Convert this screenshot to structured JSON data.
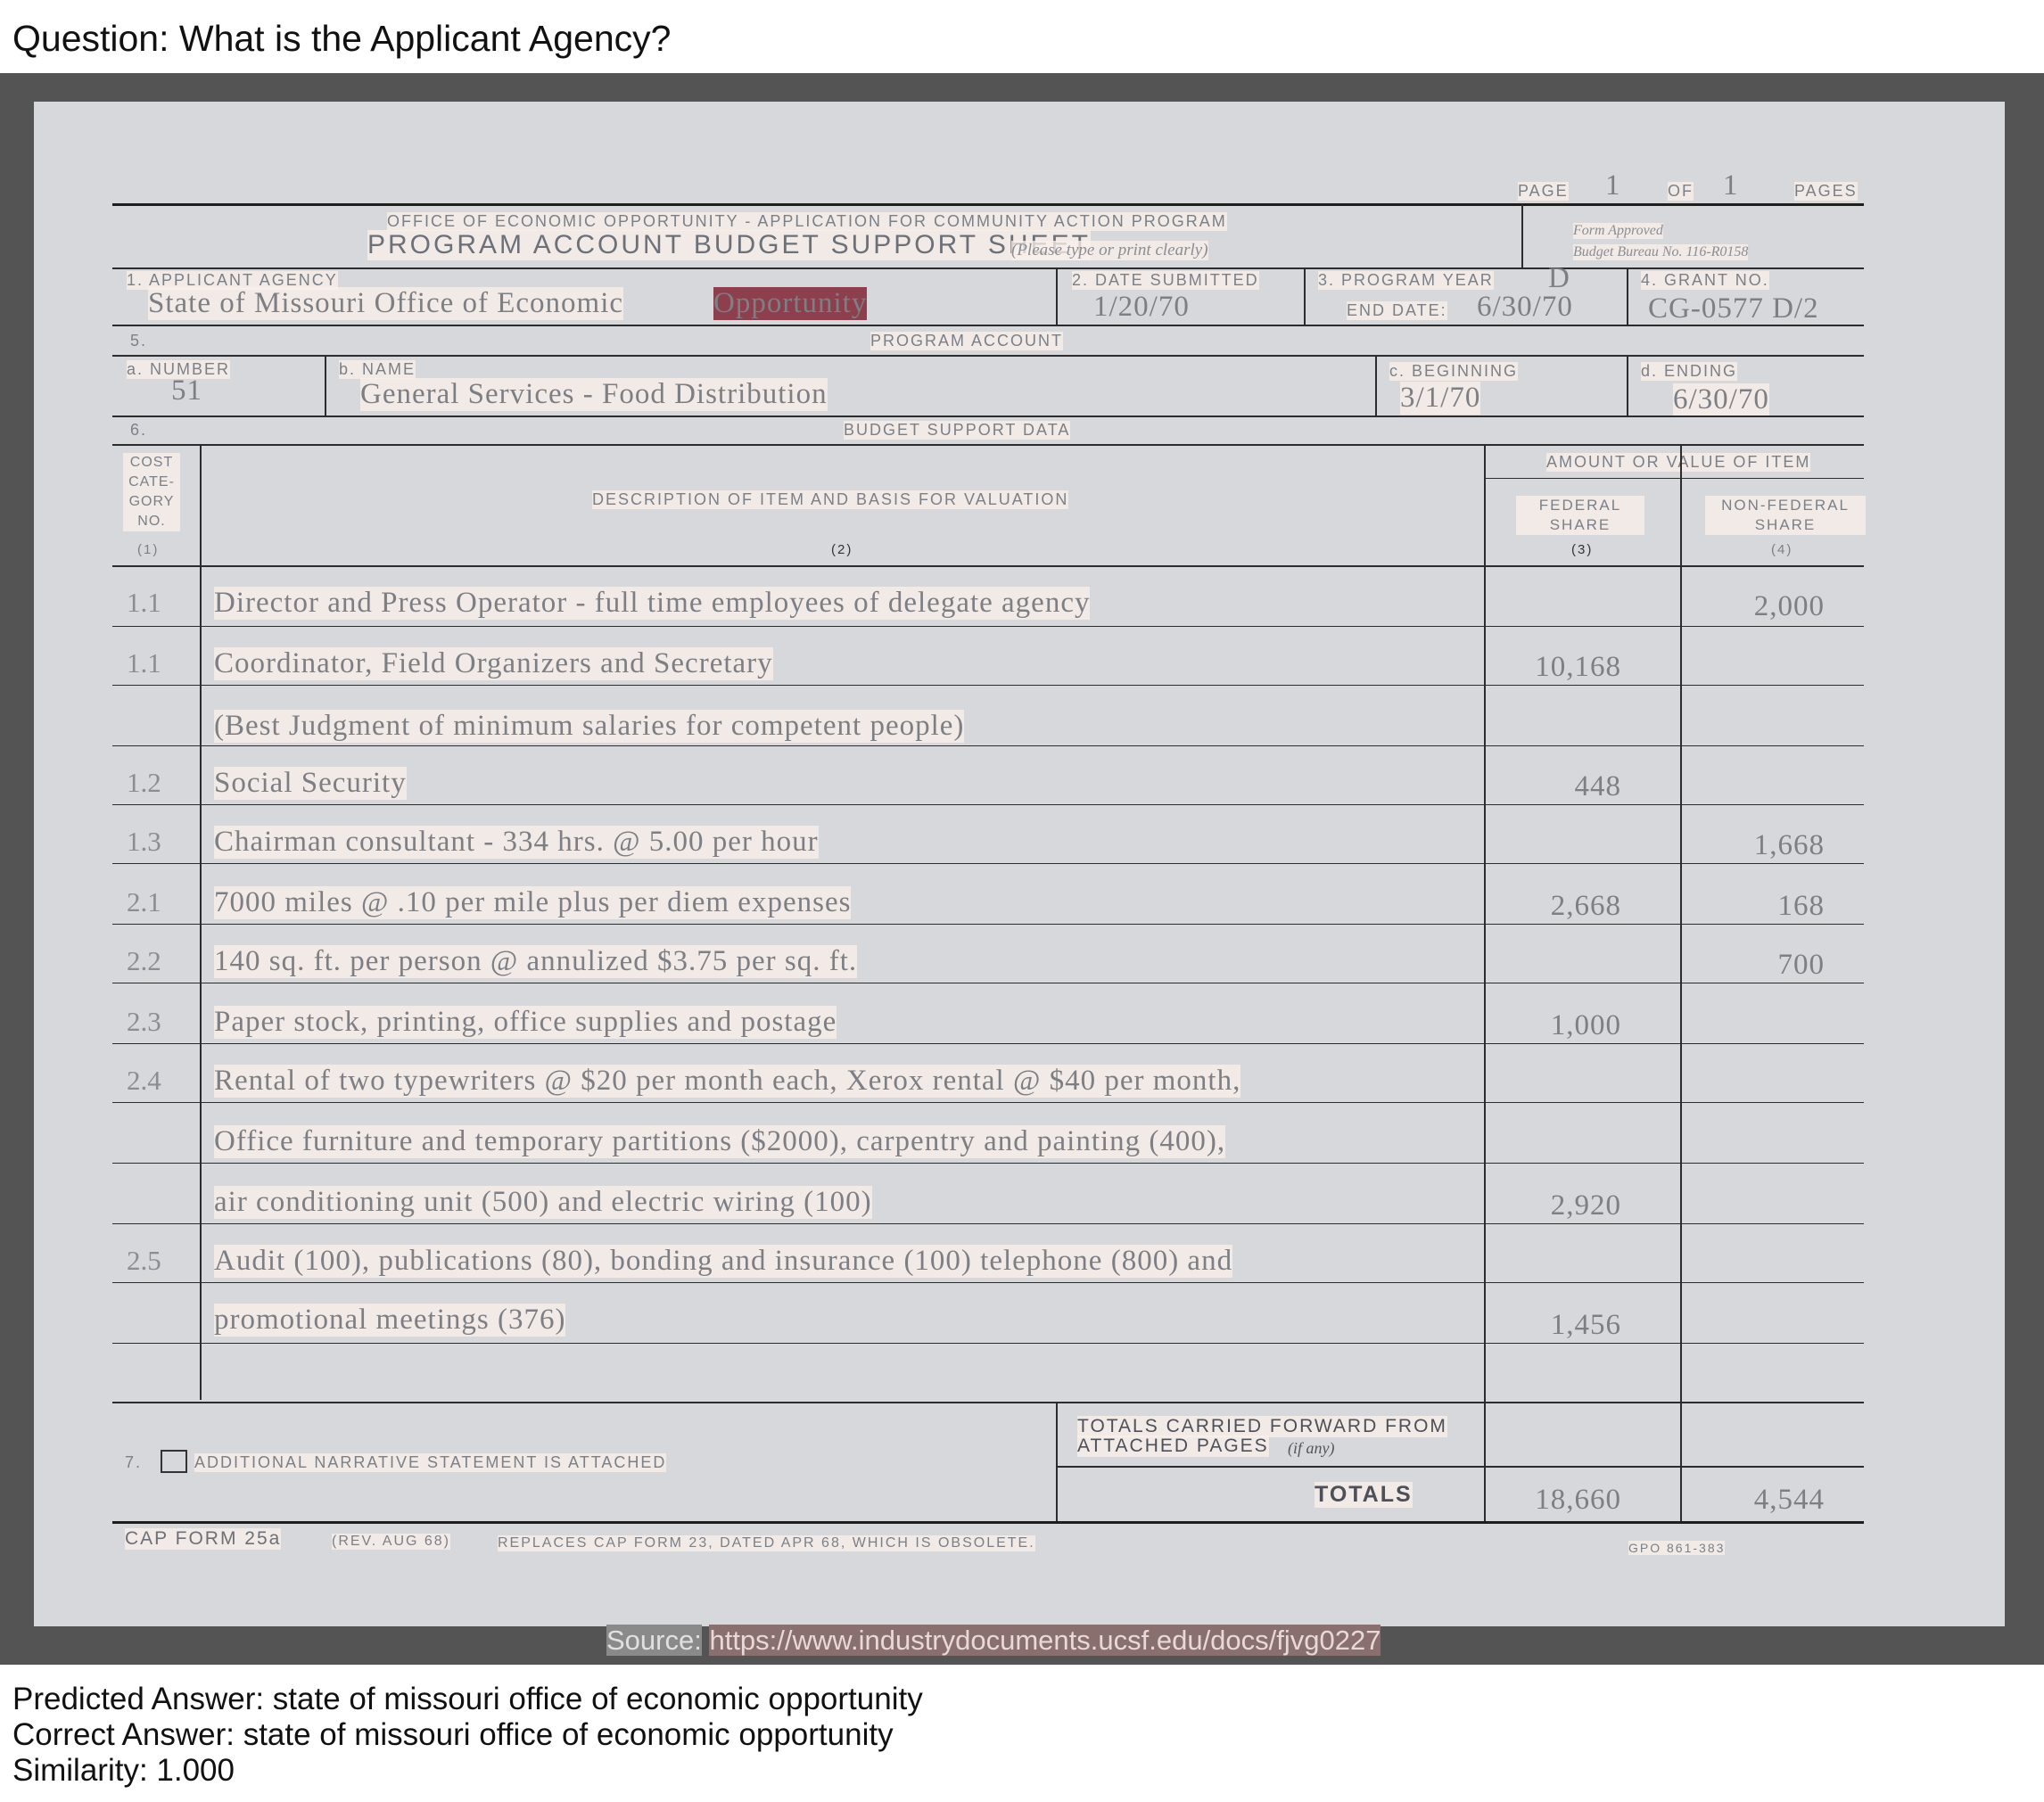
{
  "question": "Question: What is the Applicant Agency?",
  "form": {
    "page_label": "PAGE",
    "page_num": "1",
    "of_label": "OF",
    "page_total": "1",
    "pages_label": "PAGES",
    "office_line": "OFFICE OF ECONOMIC OPPORTUNITY - APPLICATION FOR COMMUNITY ACTION PROGRAM",
    "title": "PROGRAM ACCOUNT BUDGET SUPPORT SHEET",
    "title_note": "(Please type or print clearly)",
    "form_approved": "Form Approved",
    "budget_bureau": "Budget Bureau No. 116-R0158",
    "applicant_agency_label": "1. APPLICANT AGENCY",
    "applicant_agency_value_a": "State of Missouri Office of Economic",
    "applicant_agency_value_b": "Opportunity",
    "date_submitted_label": "2. DATE SUBMITTED",
    "date_submitted_value": "1/20/70",
    "program_year_label": "3. PROGRAM YEAR",
    "program_year_value": "D",
    "end_date_label": "END DATE:",
    "end_date_value": "6/30/70",
    "grant_no_label": "4. GRANT NO.",
    "grant_no_value": "CG-0577 D/2",
    "section5_num": "5.",
    "program_account_label": "PROGRAM ACCOUNT",
    "number_label": "a. NUMBER",
    "number_value": "51",
    "name_label": "b. NAME",
    "name_value": "General Services - Food Distribution",
    "beginning_label": "c. BEGINNING",
    "beginning_value": "3/1/70",
    "ending_label": "d. ENDING",
    "ending_value": "6/30/70",
    "section6_num": "6.",
    "budget_support_label": "BUDGET SUPPORT DATA",
    "col1_header": [
      "COST",
      "CATE-",
      "GORY",
      "NO."
    ],
    "col1_num": "(1)",
    "col2_header": "DESCRIPTION OF ITEM AND BASIS FOR VALUATION",
    "col2_num": "(2)",
    "amount_header": "AMOUNT OR VALUE OF ITEM",
    "col3_header": [
      "FEDERAL",
      "SHARE"
    ],
    "col3_num": "(3)",
    "col4_header": [
      "NON-FEDERAL",
      "SHARE"
    ],
    "col4_num": "(4)",
    "rows": [
      {
        "cat": "1.1",
        "desc": "Director and Press Operator - full time employees of delegate agency",
        "fed": "",
        "nonfed": "2,000"
      },
      {
        "cat": "1.1",
        "desc": "Coordinator, Field Organizers and Secretary",
        "fed": "10,168",
        "nonfed": ""
      },
      {
        "cat": "",
        "desc": "(Best Judgment of minimum salaries for competent people)",
        "fed": "",
        "nonfed": ""
      },
      {
        "cat": "1.2",
        "desc": "Social Security",
        "fed": "448",
        "nonfed": ""
      },
      {
        "cat": "1.3",
        "desc": "Chairman consultant - 334 hrs. @ 5.00 per hour",
        "fed": "",
        "nonfed": "1,668"
      },
      {
        "cat": "2.1",
        "desc": "7000 miles @ .10 per mile plus per diem expenses",
        "fed": "2,668",
        "nonfed": "168"
      },
      {
        "cat": "2.2",
        "desc": "140 sq. ft. per person @ annulized $3.75 per sq. ft.",
        "fed": "",
        "nonfed": "700"
      },
      {
        "cat": "2.3",
        "desc": "Paper stock, printing, office supplies and postage",
        "fed": "1,000",
        "nonfed": ""
      },
      {
        "cat": "2.4",
        "desc": "Rental of two typewriters @ $20 per month each, Xerox rental @ $40 per month,",
        "fed": "",
        "nonfed": ""
      },
      {
        "cat": "",
        "desc": "Office furniture and temporary partitions ($2000), carpentry and painting (400),",
        "fed": "",
        "nonfed": ""
      },
      {
        "cat": "",
        "desc": "air conditioning unit (500) and electric wiring (100)",
        "fed": "2,920",
        "nonfed": ""
      },
      {
        "cat": "2.5",
        "desc": "Audit (100), publications (80), bonding and insurance (100) telephone (800) and",
        "fed": "",
        "nonfed": ""
      },
      {
        "cat": "",
        "desc": "promotional meetings (376)",
        "fed": "1,456",
        "nonfed": ""
      }
    ],
    "section7_num": "7.",
    "narrative_label": "ADDITIONAL NARRATIVE STATEMENT IS ATTACHED",
    "totals_forward_label": "TOTALS CARRIED FORWARD FROM",
    "attached_pages_label": "ATTACHED PAGES",
    "if_any_label": "(if any)",
    "totals_label": "TOTALS",
    "total_fed": "18,660",
    "total_nonfed": "4,544",
    "cap_form": "CAP FORM 25a",
    "rev": "(REV. AUG 68)",
    "replaces": "REPLACES CAP FORM 23, DATED APR 68, WHICH IS OBSOLETE.",
    "gpo": "GPO 861-383"
  },
  "source": {
    "label": "Source:",
    "url": "https://www.industrydocuments.ucsf.edu/docs/fjvg0227"
  },
  "predicted_answer": "Predicted Answer: state of missouri office of economic opportunity",
  "correct_answer": "Correct Answer: state of missouri office of economic opportunity",
  "similarity": "Similarity: 1.000"
}
